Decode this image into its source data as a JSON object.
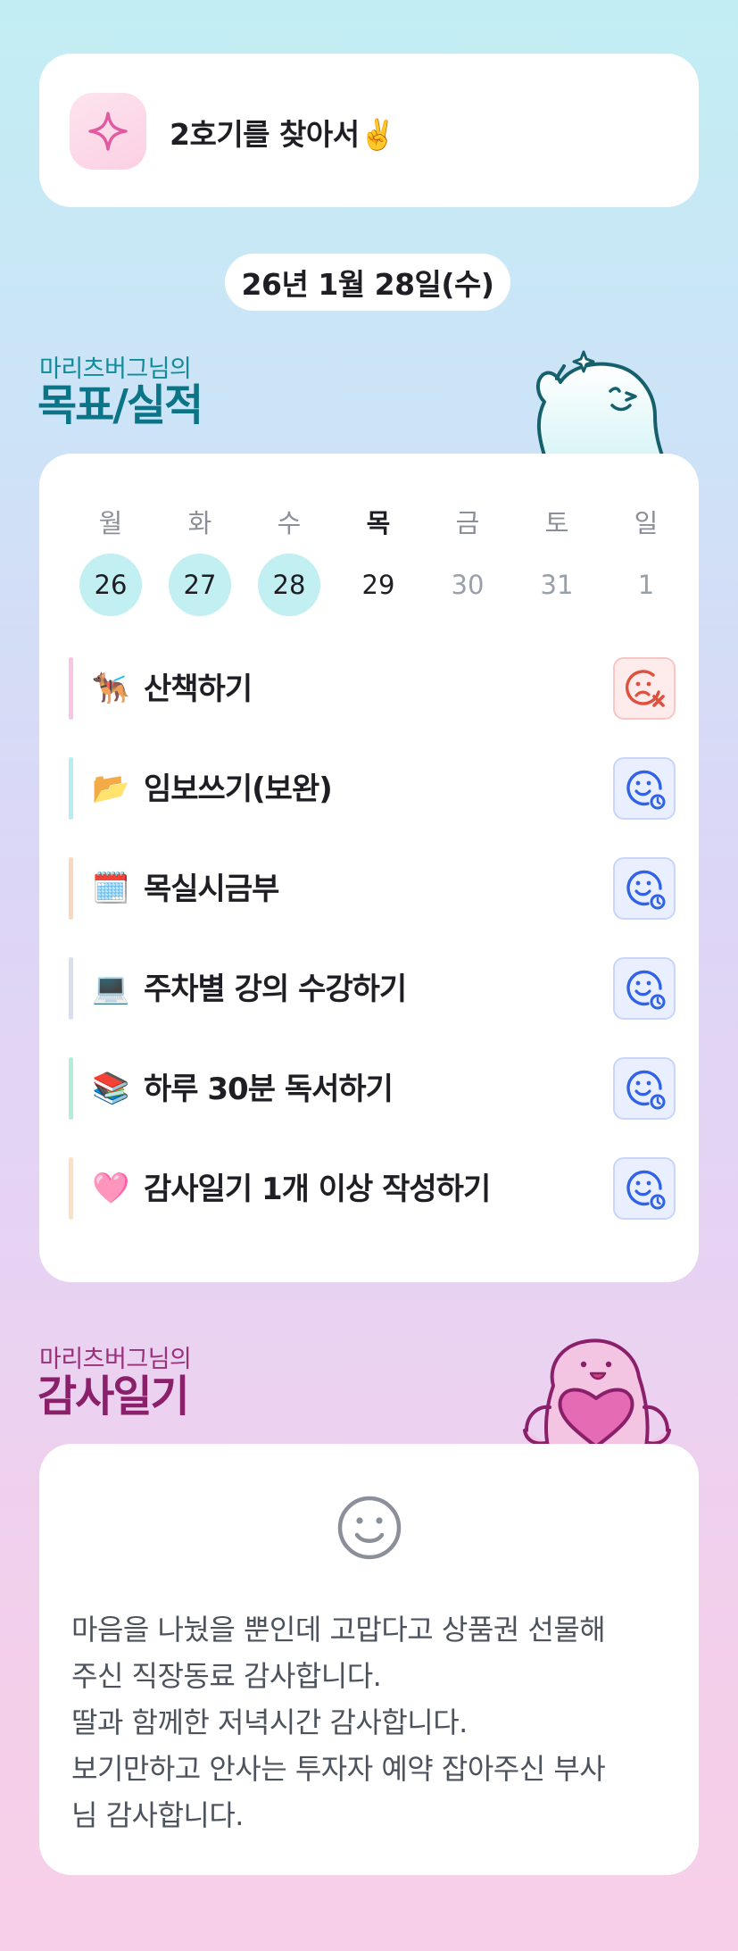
{
  "header": {
    "title": "2호기를 찾아서✌️",
    "icon": "sparkle-icon",
    "icon_color": "#e05aa0"
  },
  "date": {
    "label": "26년 1월 28일(수)"
  },
  "goals_section": {
    "subtitle": "마리츠버그님의",
    "title": "목표/실적",
    "color": "#0b7486"
  },
  "week": {
    "days": [
      {
        "weekday": "월",
        "date": "26",
        "state": "done"
      },
      {
        "weekday": "화",
        "date": "27",
        "state": "done"
      },
      {
        "weekday": "수",
        "date": "28",
        "state": "done"
      },
      {
        "weekday": "목",
        "date": "29",
        "state": "today"
      },
      {
        "weekday": "금",
        "date": "30",
        "state": "future"
      },
      {
        "weekday": "토",
        "date": "31",
        "state": "future"
      },
      {
        "weekday": "일",
        "date": "1",
        "state": "future"
      }
    ]
  },
  "goals": [
    {
      "emoji": "🐕‍🦺",
      "label": "산책하기",
      "bar_color": "#f7c6e6",
      "status": "fail",
      "status_icon": "sad-x-face-icon"
    },
    {
      "emoji": "📂",
      "label": "임보쓰기(보완)",
      "bar_color": "#b7ecf1",
      "status": "pending",
      "status_icon": "smile-clock-face-icon"
    },
    {
      "emoji": "🗓️",
      "label": "목실시금부",
      "bar_color": "#fbd8bd",
      "status": "pending",
      "status_icon": "smile-clock-face-icon"
    },
    {
      "emoji": "💻",
      "label": "주차별 강의 수강하기",
      "bar_color": "#d6e0ef",
      "status": "pending",
      "status_icon": "smile-clock-face-icon"
    },
    {
      "emoji": "📚",
      "label": "하루 30분 독서하기",
      "bar_color": "#b5ecd9",
      "status": "pending",
      "status_icon": "smile-clock-face-icon"
    },
    {
      "emoji": "🩷",
      "label": "감사일기 1개 이상 작성하기",
      "bar_color": "#fde0c3",
      "status": "pending",
      "status_icon": "smile-clock-face-icon"
    }
  ],
  "gratitude_section": {
    "subtitle": "마리츠버그님의",
    "title": "감사일기",
    "color": "#8a1f6a"
  },
  "gratitude": {
    "icon": "smile-face-icon",
    "lines": [
      "마음을 나눴을 뿐인데 고맙다고 상품권 선물해",
      "주신 직장동료 감사합니다.",
      "딸과 함께한 저녁시간 감사합니다.",
      "보기만하고 안사는 투자자 예약 잡아주신 부사",
      "님 감사합니다."
    ]
  }
}
